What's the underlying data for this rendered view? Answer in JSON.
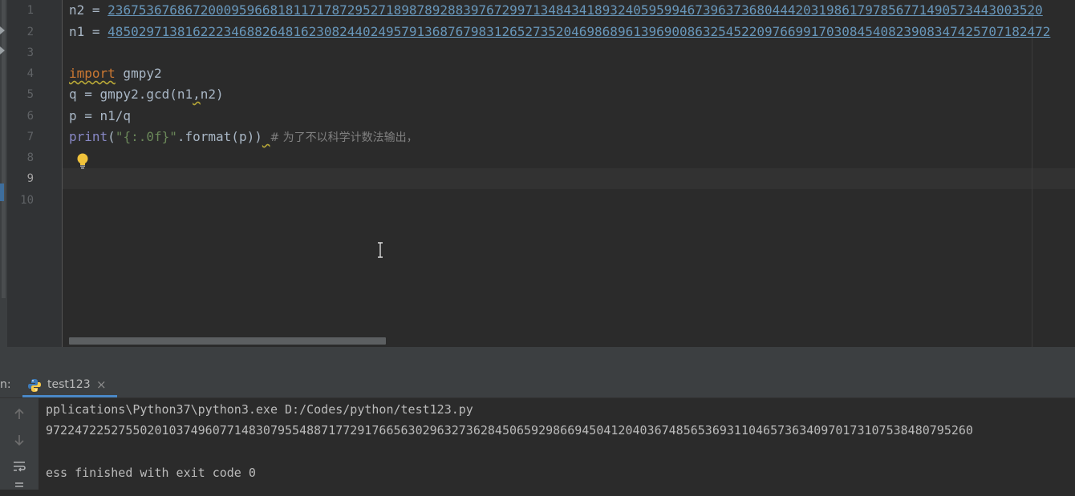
{
  "editor": {
    "line_numbers": [
      "1",
      "2",
      "3",
      "4",
      "5",
      "6",
      "7",
      "8",
      "9",
      "10"
    ],
    "current_line": "9",
    "lines": {
      "l1_prefix": "n2 = ",
      "l1_value": "2367536768672000959668181171787295271898789288397672997134843418932405959946739637368044420319861797856771490573443003520",
      "l2_prefix": "n1 = ",
      "l2_value": "48502971381622234688264816230824402495791368767983126527352046986896139690086325452209766991703084540823908347425707182472",
      "l4_keyword": "import",
      "l4_rest": " gmpy2",
      "l5_a": "q = gmpy2.gcd(n1",
      "l5_b": ",",
      "l5_c": "n2)",
      "l6": "p = n1/q",
      "l7_builtin": "print",
      "l7_paren": "(",
      "l7_string": "\"{:.0f}\"",
      "l7_rest": ".format(p))",
      "l7_space": " ",
      "l7_comment": "# 为了不以科学计数法输出，"
    }
  },
  "run_panel": {
    "label": "n:",
    "tab_label": "test123",
    "tab_close": "×",
    "console_lines": [
      "pplications\\Python37\\python3.exe D:/Codes/python/test123.py",
      "97224722527550201037496077148307955488717729176656302963273628450659298669450412040367485653693110465736340970173107538480795260",
      "",
      "ess finished with exit code 0"
    ]
  },
  "icons": {
    "bulb": "lightbulb-icon",
    "python": "python-file-icon",
    "up": "arrow-up-icon",
    "down": "arrow-down-icon",
    "wrap": "soft-wrap-icon",
    "cursor": "text-cursor-icon"
  },
  "colors": {
    "background": "#2b2b2b",
    "keyword": "#cc7832",
    "number": "#6897bb",
    "string": "#6a8759",
    "builtin": "#8888c6",
    "comment": "#808080",
    "accent": "#4a88c7"
  }
}
